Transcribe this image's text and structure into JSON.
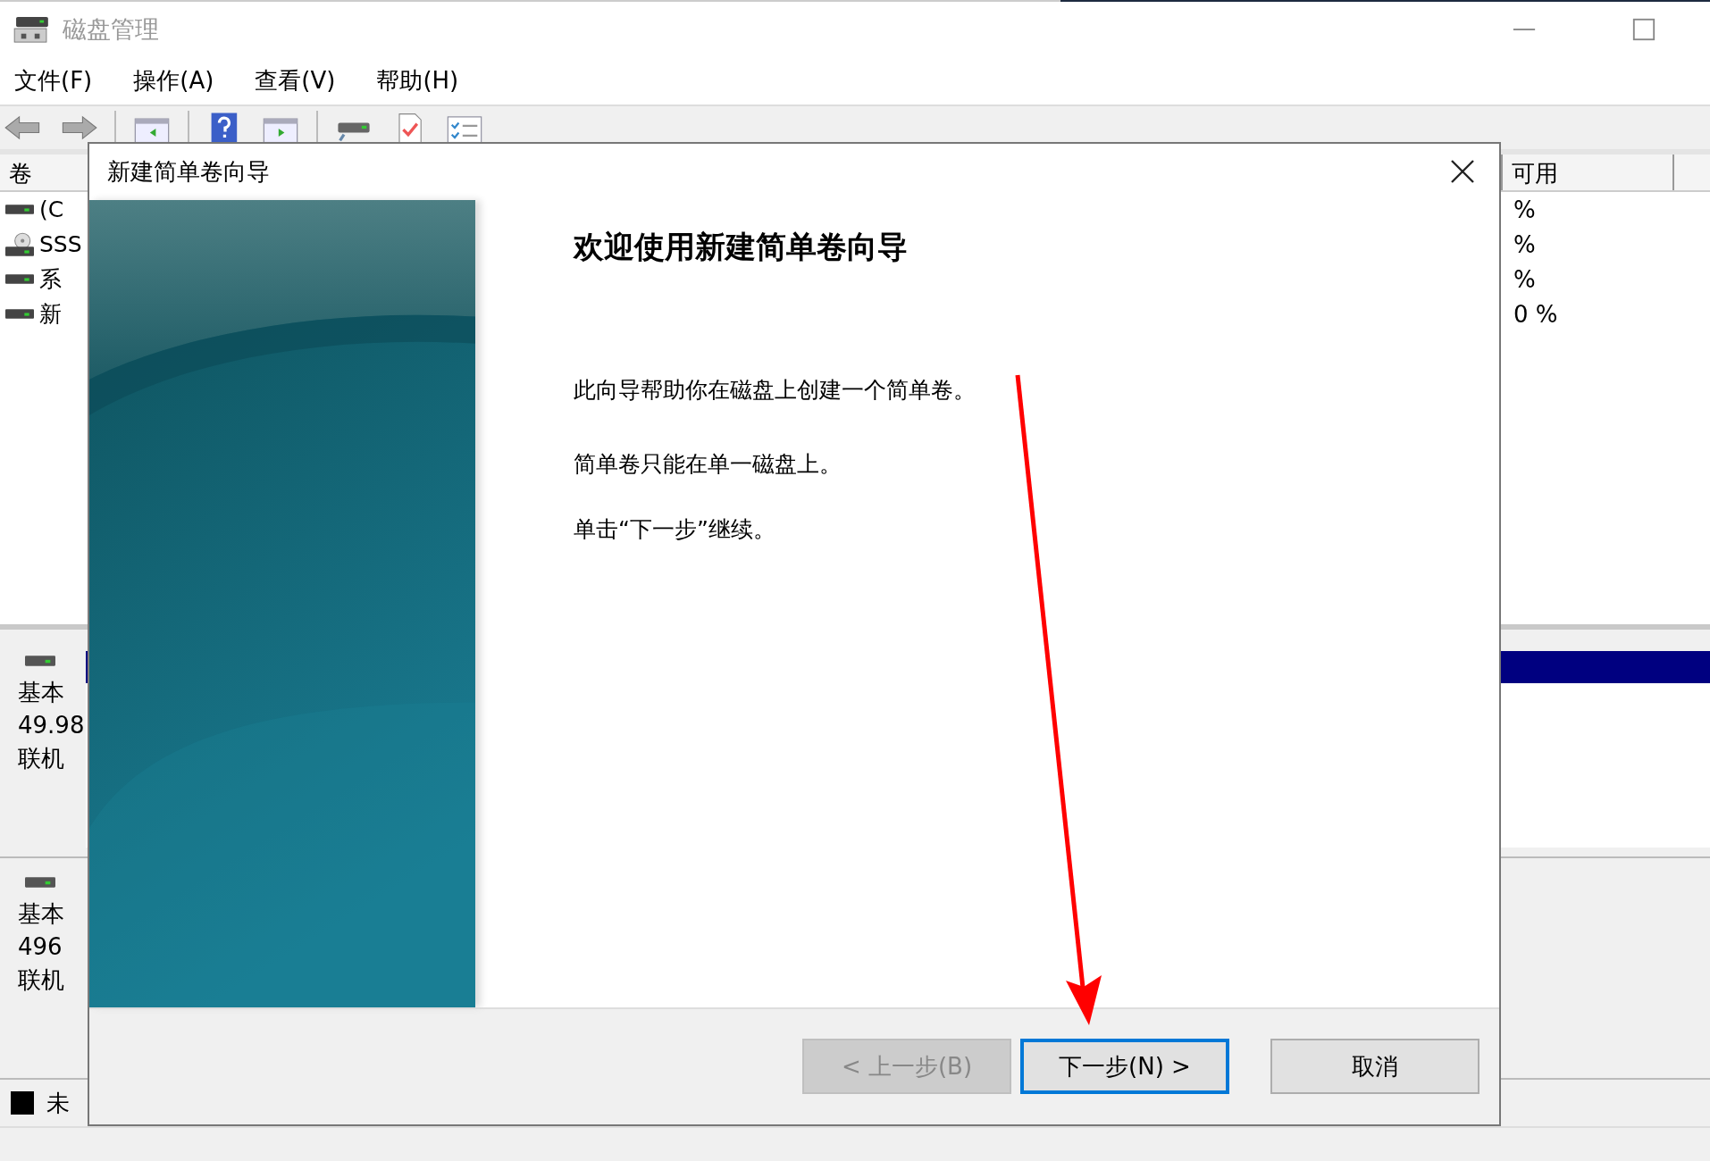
{
  "window": {
    "title": "磁盘管理"
  },
  "menu": [
    {
      "label": "文件(F)"
    },
    {
      "label": "操作(A)"
    },
    {
      "label": "查看(V)"
    },
    {
      "label": "帮助(H)"
    }
  ],
  "volume_list": {
    "columns": [
      "卷",
      "可用"
    ],
    "rows": [
      {
        "kind": "drive",
        "name": "(C",
        "free": "%"
      },
      {
        "kind": "disc",
        "name": "SSS",
        "free": "%"
      },
      {
        "kind": "drive",
        "name": "系",
        "free": "%"
      },
      {
        "kind": "drive",
        "name": "新",
        "free": "0 %"
      }
    ]
  },
  "disks": [
    {
      "lines": [
        "基本",
        "49.98",
        "联机"
      ],
      "partition": true
    },
    {
      "lines": [
        "基本",
        "496",
        "联机"
      ],
      "partition": false
    }
  ],
  "legend": [
    {
      "label": "未",
      "color": "#000000"
    }
  ],
  "dialog": {
    "title": "新建简单卷向导",
    "heading": "欢迎使用新建简单卷向导",
    "paragraphs": [
      "此向导帮助你在磁盘上创建一个简单卷。",
      "简单卷只能在单一磁盘上。",
      "单击“下一步”继续。"
    ],
    "buttons": [
      {
        "label": "< 上一步(B)",
        "disabled": true,
        "default": false
      },
      {
        "label": "下一步(N) >",
        "disabled": false,
        "default": true
      },
      {
        "label": "取消",
        "disabled": false,
        "default": false
      }
    ]
  }
}
